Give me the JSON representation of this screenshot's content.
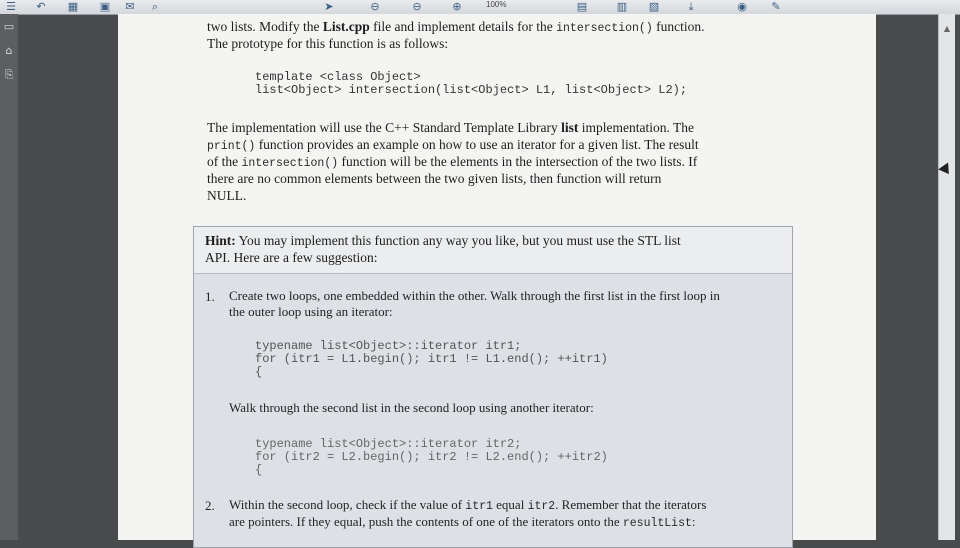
{
  "toolbar": {
    "zoom": "100%",
    "icons": [
      "menu-icon",
      "back-icon",
      "print-icon",
      "page-icon",
      "mail-icon",
      "search-icon",
      "separator",
      "hand-icon",
      "cursor-icon",
      "zoom-out-icon",
      "zoom-in-icon",
      "fit-page-icon",
      "fit-width-icon",
      "rotate-icon",
      "download-icon",
      "comment-icon",
      "sign-icon"
    ]
  },
  "intro": {
    "line1_pre": "two lists. Modify the ",
    "line1_file": "List.cpp",
    "line1_mid": " file and implement details for the ",
    "line1_func": "intersection()",
    "line1_post": " function.",
    "line2": "The prototype for this function is as follows:"
  },
  "prototype": {
    "line1": "template <class Object>",
    "line2": "list<Object> intersection(list<Object> L1, list<Object> L2);"
  },
  "implementation": {
    "l1_pre": "The implementation will use the C++ Standard Template Library ",
    "l1_bold": "list",
    "l1_post": " implementation. The",
    "l2_func": "print()",
    "l2_post": " function provides an example on how to use an iterator for a given list. The result",
    "l3_pre": "of the ",
    "l3_func": "intersection()",
    "l3_post": " function will be the elements in the intersection of the two lists. If",
    "l4": "there are no common elements between the two given lists, then function will return",
    "l5": "NULL."
  },
  "hint": {
    "label": "Hint:",
    "l1": " You may implement this function any way you like, but you must use the STL list",
    "l2": "API. Here are a few suggestion:",
    "items": [
      {
        "num": "1.",
        "text1": "Create two loops, one embedded within the other. Walk through the first list in the first loop in",
        "text2": "the outer loop using an iterator:",
        "code1": [
          "typename list<Object>::iterator itr1;",
          "for (itr1 = L1.begin(); itr1 != L1.end(); ++itr1)",
          "{"
        ],
        "mid": "Walk through the second list in the second loop using another iterator:",
        "code2": [
          "typename list<Object>::iterator itr2;",
          "for (itr2 = L2.begin(); itr2 != L2.end(); ++itr2)",
          "{"
        ]
      },
      {
        "num": "2.",
        "t1_pre": "Within the second loop, check if the value of ",
        "t1_c1": "itr1",
        "t1_mid": " equal ",
        "t1_c2": "itr2",
        "t1_post": ". Remember that the iterators",
        "t2_pre": "are pointers. If they equal, push the contents of one of the iterators onto the ",
        "t2_code": "resultList",
        "t2_post": ":"
      }
    ]
  }
}
